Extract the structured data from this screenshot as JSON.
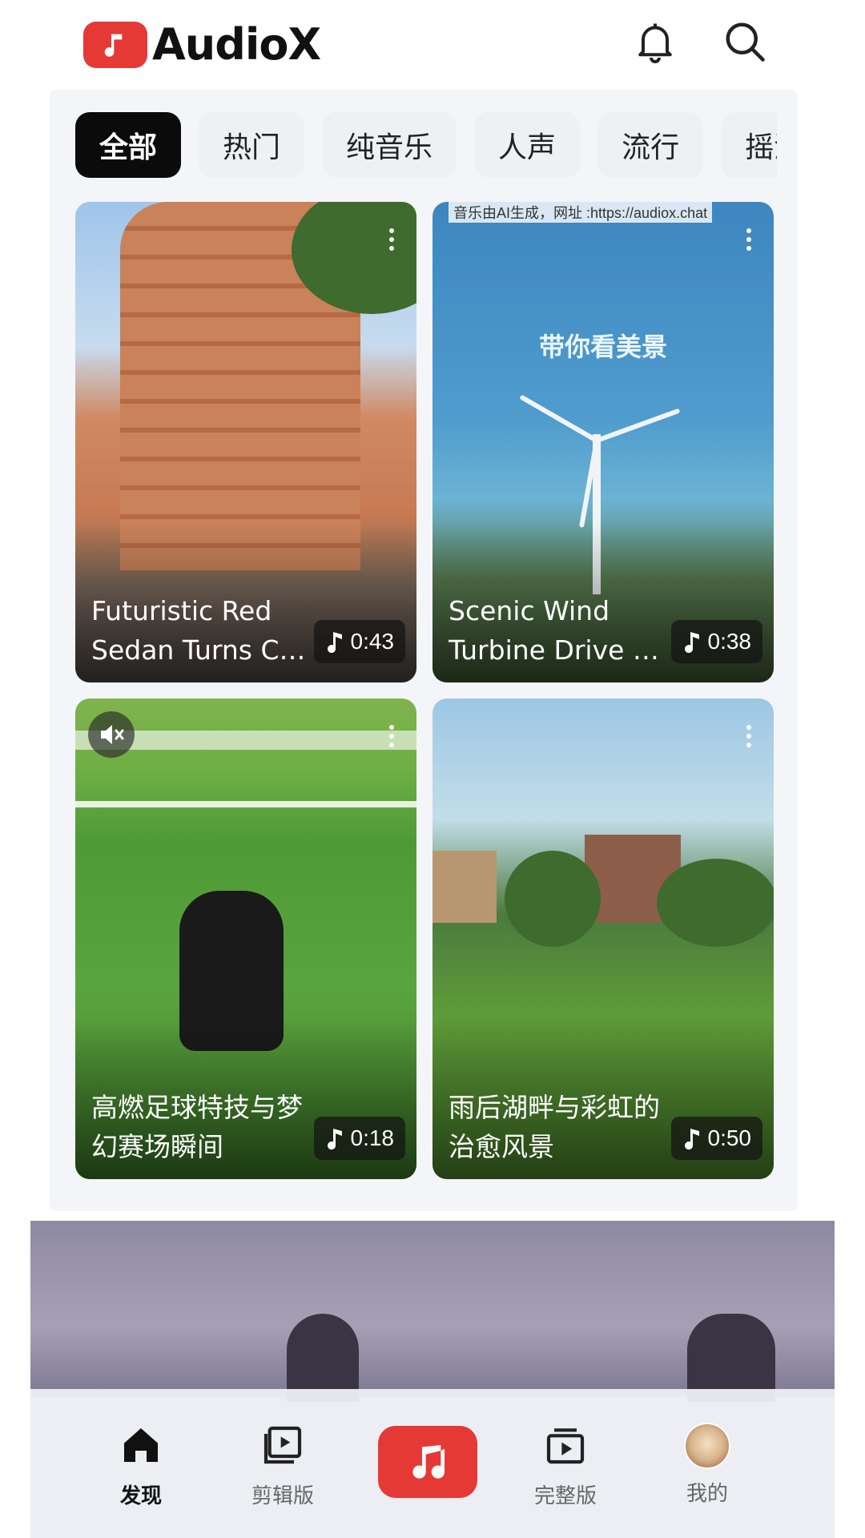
{
  "app": {
    "name": "AudioX"
  },
  "header": {
    "notifications_icon": "bell-icon",
    "search_icon": "search-icon"
  },
  "tabs": [
    "全部",
    "热门",
    "纯音乐",
    "人声",
    "流行",
    "摇滚"
  ],
  "active_tab": "全部",
  "cards": [
    {
      "title_line1": "Futuristic Red",
      "title_line2": "Sedan Turns Ci…",
      "duration": "0:43"
    },
    {
      "title_line1": "Scenic Wind",
      "title_line2": "Turbine Drive T…",
      "duration": "0:38",
      "overlay_text": "带你看美景",
      "watermark": "音乐由AI生成，网址 :https://audiox.chat"
    },
    {
      "title_line1": "高燃足球特技与梦",
      "title_line2": "幻赛场瞬间",
      "duration": "0:18"
    },
    {
      "title_line1": "雨后湖畔与彩虹的",
      "title_line2": "治愈风景",
      "duration": "0:50"
    }
  ],
  "bottom_nav": [
    {
      "label": "发现",
      "icon": "home-icon",
      "active": true
    },
    {
      "label": "剪辑版",
      "icon": "video-clip-icon",
      "active": false
    },
    {
      "label": "",
      "icon": "music-note-icon",
      "active": false
    },
    {
      "label": "完整版",
      "icon": "video-library-icon",
      "active": false
    },
    {
      "label": "我的",
      "icon": "avatar",
      "active": false
    }
  ],
  "colors": {
    "brand": "#e53935",
    "active_tab_bg": "#0b0b0b",
    "tab_bg": "#eef0f3"
  }
}
